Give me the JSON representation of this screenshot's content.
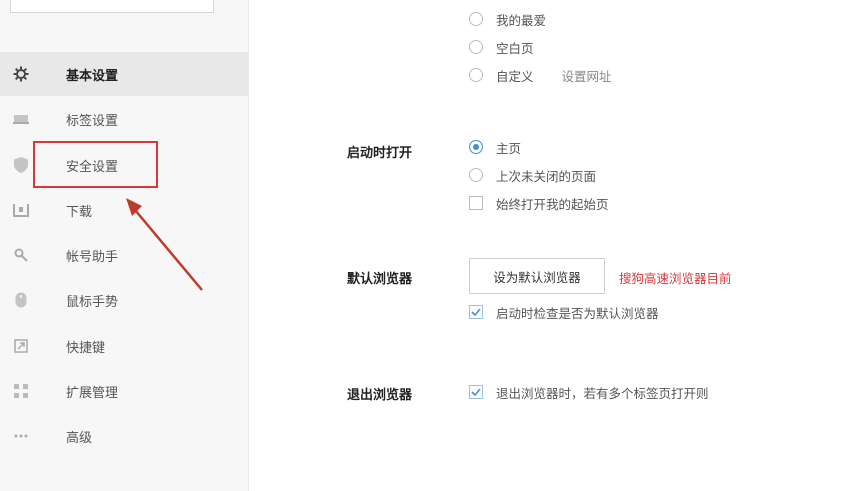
{
  "sidebar": {
    "items": [
      {
        "label": "基本设置",
        "icon": "gear-icon"
      },
      {
        "label": "标签设置",
        "icon": "tab-icon"
      },
      {
        "label": "安全设置",
        "icon": "shield-icon"
      },
      {
        "label": "下载",
        "icon": "download-icon"
      },
      {
        "label": "帐号助手",
        "icon": "key-icon"
      },
      {
        "label": "鼠标手势",
        "icon": "mouse-icon"
      },
      {
        "label": "快捷键",
        "icon": "shortcut-icon"
      },
      {
        "label": "扩展管理",
        "icon": "grid-icon"
      },
      {
        "label": "高级",
        "icon": "more-icon"
      }
    ],
    "active_index": 0,
    "highlighted_index": 2
  },
  "main": {
    "homepage_options": {
      "favorites": "我的最爱",
      "blank": "空白页",
      "custom": "自定义",
      "custom_link": "设置网址"
    },
    "startup": {
      "label": "启动时打开",
      "home": "主页",
      "last_session": "上次未关闭的页面",
      "always_open_start": "始终打开我的起始页"
    },
    "default_browser": {
      "label": "默认浏览器",
      "button": "设为默认浏览器",
      "note": "搜狗高速浏览器目前",
      "check_on_start": "启动时检查是否为默认浏览器"
    },
    "exit_browser": {
      "label": "退出浏览器",
      "warn_multiple_tabs": "退出浏览器时，若有多个标签页打开则"
    }
  },
  "colors": {
    "accent": "#3d8ee0",
    "highlight_red": "#d9383a"
  }
}
